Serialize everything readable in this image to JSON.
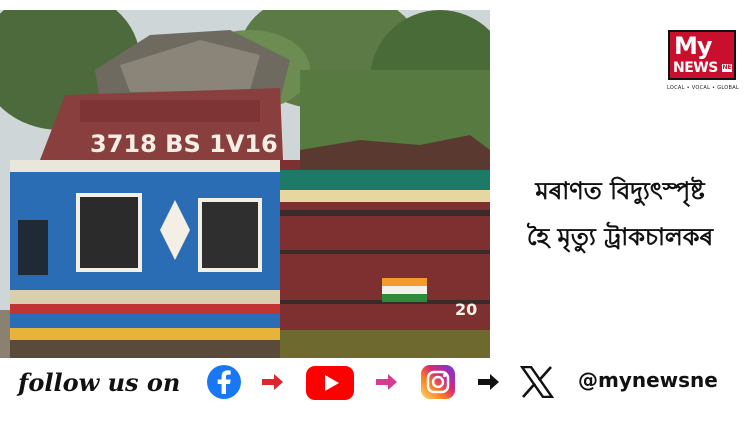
{
  "headline": {
    "line1": "মৰাণত বিদ্যুৎস্পৃষ্ট",
    "line2": "হৈ মৃত্যু ট্ৰাকচালকৰ"
  },
  "photo": {
    "truck_number": "3718 BS 1V16"
  },
  "brand": {
    "logo_top": "My",
    "logo_bottom": "NEWS",
    "logo_badge": "NE",
    "tagline": "LOCAL • VOCAL • GLOBAL",
    "color": "#c8102e"
  },
  "social": {
    "follow_text": "follow us on",
    "handle": "@mynewsne",
    "icons": [
      "facebook-icon",
      "youtube-icon",
      "instagram-icon",
      "x-icon"
    ],
    "arrow_colors": [
      "#e0262d",
      "#e0262d",
      "#d63c8f",
      "#111111"
    ]
  }
}
